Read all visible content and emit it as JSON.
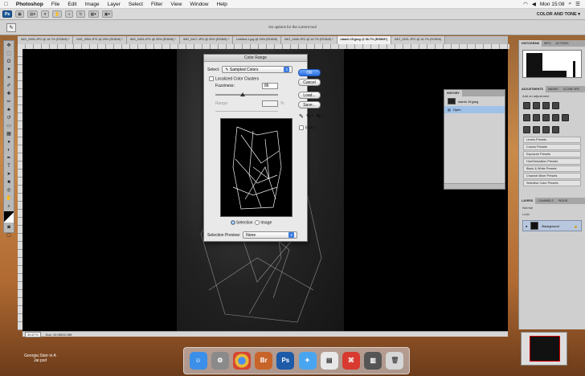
{
  "menubar": {
    "apple": "",
    "app": "Photoshop",
    "items": [
      "File",
      "Edit",
      "Image",
      "Layer",
      "Select",
      "Filter",
      "View",
      "Window",
      "Help"
    ],
    "clock": "Mon 15:08"
  },
  "appbar": {
    "workspace": "COLOR AND TONE ▾",
    "ps_badge": "Ps"
  },
  "optionsbar": {
    "message": "No options for the current tool"
  },
  "tabs": [
    "IMG_0590.JPG @ 16.7% (RGB/8) *",
    "IMG_0594.JPG @ 25% (RGB/8) *",
    "IMG_0405.JPG @ 25% (RGB/8) *",
    "IMG_0417.JPG @ 25% (RGB/8) *",
    "Untitled-1.jpg @ 25% (RGB/8)",
    "IMG_0466.JPG @ 16.7% (RGB/8) *",
    "niamh 19.jpeg @ 36.7% (RGB/8*)",
    "IMG_0491.JPG @ 16.7% (RGB/8)"
  ],
  "active_tab_index": 6,
  "statusbar": {
    "zoom": "35.67%",
    "doc": "Doc: 10.0M/10.0M"
  },
  "dialog": {
    "title": "Color Range",
    "select_label": "Select:",
    "select_value": "Sampled Colors",
    "localized_label": "Localized Color Clusters",
    "fuzziness_label": "Fuzziness:",
    "fuzziness_value": "86",
    "range_label": "Range:",
    "range_unit": "%",
    "ok": "OK",
    "cancel": "Cancel",
    "load": "Load...",
    "save": "Save...",
    "invert": "Invert",
    "radio_selection": "Selection",
    "radio_image": "Image",
    "preview_label": "Selection Preview:",
    "preview_value": "None",
    "fuzziness_level": 0.43
  },
  "history": {
    "title": "HISTORY",
    "snapshot": "niamh 19.jpeg",
    "step": "Open"
  },
  "right_panels": {
    "top_tabs": [
      "HISTOGRAM",
      "INFO",
      "ACTIONS"
    ],
    "adj_tabs": [
      "ADJUSTMENTS",
      "MASKS",
      "CLONE SRC"
    ],
    "adj_label": "Add an adjustment",
    "presets": [
      "Levels Presets",
      "Curves Presets",
      "Exposure Presets",
      "Hue/Saturation Presets",
      "Black & White Presets",
      "Channel Mixer Presets",
      "Selective Color Presets"
    ],
    "layer_tabs": [
      "LAYERS",
      "CHANNELS",
      "PATHS"
    ],
    "layer_mode": "Normal",
    "lock_label": "Lock:",
    "layer_name": "Background"
  },
  "desktop": {
    "file_label": "Georgia Starr in A Jar.psd"
  },
  "dock": {
    "items": [
      "finder",
      "prefs",
      "chrome",
      "Br",
      "Ps",
      "safari",
      "preview",
      "acrobat",
      "finder2",
      "trash"
    ]
  }
}
